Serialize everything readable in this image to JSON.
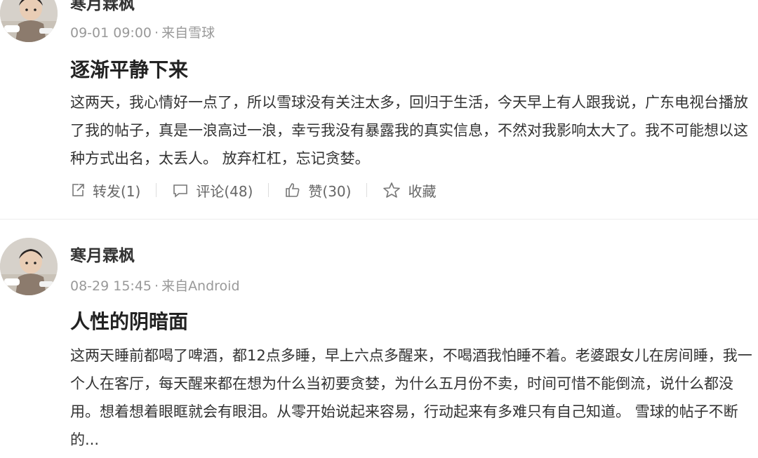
{
  "posts": [
    {
      "author": "寒月霖枫",
      "date": "09-01 09:00",
      "source": "来自雪球",
      "title": "逐渐平静下来",
      "body": "这两天，我心情好一点了，所以雪球没有关注太多，回归于生活，今天早上有人跟我说，广东电视台播放了我的帖子，真是一浪高过一浪，幸亏我没有暴露我的真实信息，不然对我影响太大了。我不可能想以这种方式出名，太丢人。 放弃杠杠，忘记贪婪。",
      "actions": {
        "repost": "转发(1)",
        "comment": "评论(48)",
        "like": "赞(30)",
        "favorite": "收藏"
      }
    },
    {
      "author": "寒月霖枫",
      "date": "08-29 15:45",
      "source": "来自Android",
      "title": "人性的阴暗面",
      "body": "这两天睡前都喝了啤酒，都12点多睡，早上六点多醒来，不喝酒我怕睡不着。老婆跟女儿在房间睡，我一个人在客厅，每天醒来都在想为什么当初要贪婪，为什么五月份不卖，时间可惜不能倒流，说什么都没用。想着想着眼眶就会有眼泪。从零开始说起来容易，行动起来有多难只有自己知道。 雪球的帖子不断的..."
    }
  ],
  "separator": "·",
  "colors": {
    "text": "#333333",
    "meta": "#999999",
    "action": "#666666"
  }
}
